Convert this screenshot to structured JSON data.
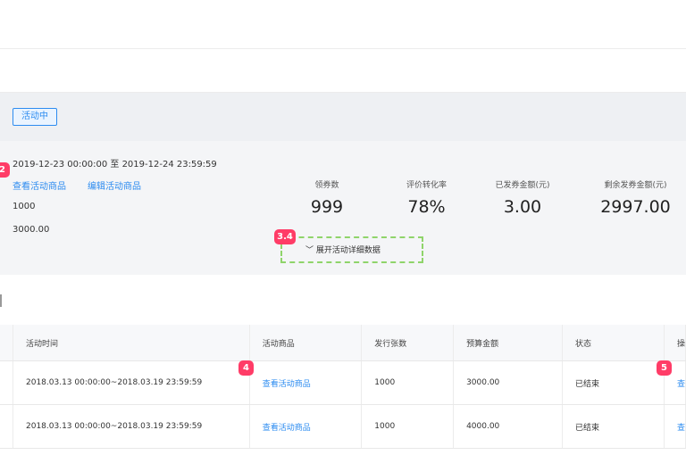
{
  "activity": {
    "status": "活动中",
    "date_range": "2019-12-23 00:00:00 至 2019-12-24 23:59:59",
    "view_goods_link": "查看活动商品",
    "edit_goods_link": "编辑活动商品",
    "issue_count": "1000",
    "budget": "3000.00"
  },
  "stats": [
    {
      "label": "领券数",
      "value": "999"
    },
    {
      "label": "评价转化率",
      "value": "78%"
    },
    {
      "label": "已发券金额(元)",
      "value": "3.00"
    },
    {
      "label": "剩余发券金额(元)",
      "value": "2997.00"
    }
  ],
  "expand_label": "展开活动详细数据",
  "markers": {
    "m2": "2",
    "m34": "3.4",
    "m4": "4",
    "m5": "5"
  },
  "table": {
    "headers": [
      "活动时间",
      "活动商品",
      "发行张数",
      "预算金额",
      "状态",
      "操"
    ],
    "rows": [
      {
        "time": "2018.03.13 00:00:00~2018.03.19 23:59:59",
        "goods": "查看活动商品",
        "count": "1000",
        "budget": "3000.00",
        "status": "已结束",
        "action": "查"
      },
      {
        "time": "2018.03.13 00:00:00~2018.03.19 23:59:59",
        "goods": "查看活动商品",
        "count": "1000",
        "budget": "4000.00",
        "status": "已结束",
        "action": "查"
      }
    ]
  },
  "colors": {
    "accent": "#2d8cf0",
    "marker": "#ff3c67",
    "dashed_outline": "#8fd46a"
  }
}
